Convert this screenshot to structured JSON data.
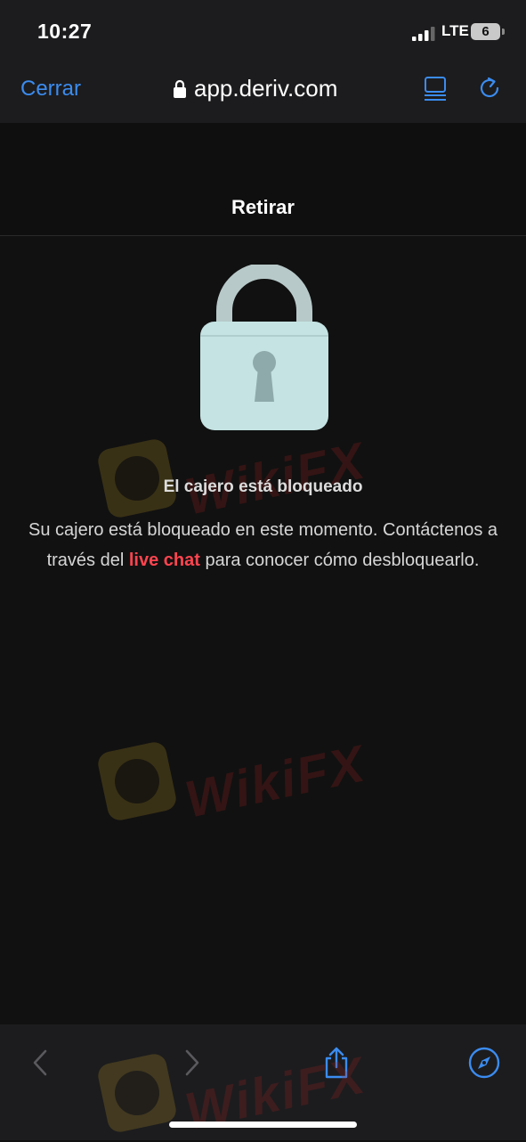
{
  "status_bar": {
    "time": "10:27",
    "network": "LTE",
    "battery": "6"
  },
  "browser": {
    "close_label": "Cerrar",
    "url": "app.deriv.com",
    "icons": [
      "reader-icon",
      "reload-icon"
    ]
  },
  "page": {
    "title": "Retirar",
    "locked_title": "El cajero está bloqueado",
    "message_part1": "Su cajero está bloqueado en este momento. Contáctenos a través del",
    "link_text": "live chat",
    "message_part2": "para conocer cómo desbloquearlo."
  },
  "watermark": {
    "text": "WikiFX"
  },
  "bottom_bar": {
    "icons": [
      "back-icon",
      "forward-icon",
      "share-icon",
      "compass-icon"
    ]
  },
  "colors": {
    "accent": "#3b8cf0",
    "link": "#ff444f",
    "background": "#111111",
    "bar": "#1c1c1e",
    "padlock_body": "#c5e3e3",
    "padlock_shackle": "#b8c9c9"
  }
}
